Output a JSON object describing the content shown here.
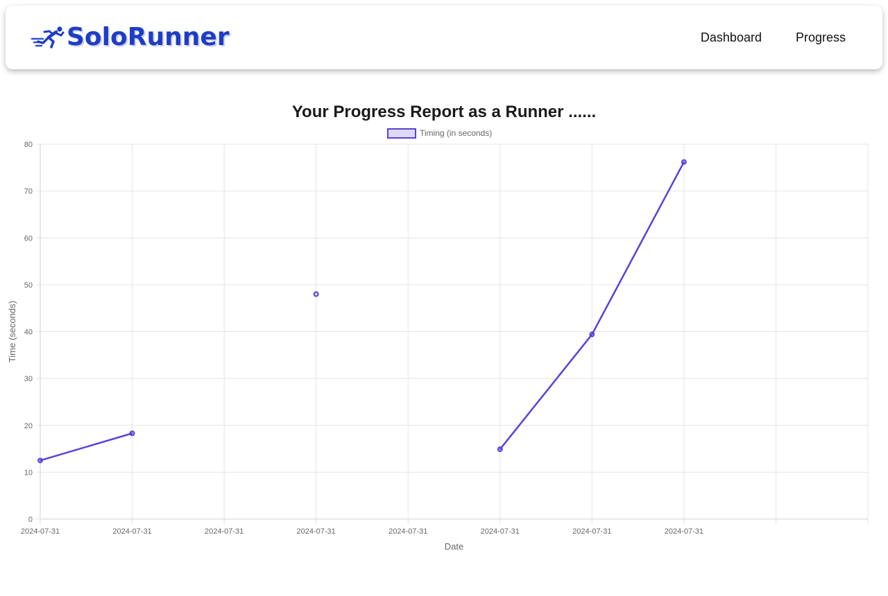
{
  "app": {
    "brand_name": "SoloRunner",
    "brand_icon": "sprinter-icon",
    "brand_color": "#1f3dc4"
  },
  "nav": {
    "items": [
      {
        "label": "Dashboard"
      },
      {
        "label": "Progress"
      }
    ]
  },
  "page": {
    "title": "Your Progress Report as a Runner ......"
  },
  "chart_data": {
    "type": "line",
    "x": [
      "2024-07-31",
      "2024-07-31",
      "2024-07-31",
      "2024-07-31",
      "2024-07-31",
      "2024-07-31",
      "2024-07-31",
      "2024-07-31",
      "",
      ""
    ],
    "series": [
      {
        "name": "Timing (in seconds)",
        "values": [
          12.5,
          18.3,
          null,
          48,
          null,
          14.9,
          39.4,
          76.2,
          null,
          null
        ],
        "color": "#5b3fd9",
        "fill": "rgba(91,63,217,0.2)"
      }
    ],
    "xlabel": "Date",
    "ylabel": "Time (seconds)",
    "ylim": [
      0,
      80
    ],
    "yticks": [
      0,
      10,
      20,
      30,
      40,
      50,
      60,
      70,
      80
    ],
    "grid": true,
    "legend": "top"
  }
}
